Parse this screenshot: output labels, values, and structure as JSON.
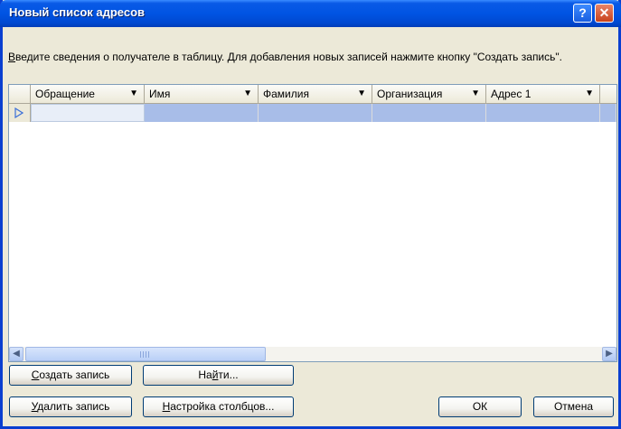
{
  "window": {
    "title": "Новый список адресов",
    "help_glyph": "?",
    "close_glyph": "✕"
  },
  "instructions": {
    "accel": "В",
    "text": "ведите сведения о получателе в таблицу. Для добавления новых записей нажмите кнопку \"Создать запись\"."
  },
  "grid": {
    "columns": [
      "Обращение",
      "Имя",
      "Фамилия",
      "Организация",
      "Адрес 1"
    ],
    "dropdown_glyph": "▼",
    "rows": [
      [
        "",
        "",
        "",
        "",
        ""
      ]
    ]
  },
  "scrollbar": {
    "left_glyph": "◀",
    "right_glyph": "▶"
  },
  "buttons": {
    "new_entry": {
      "accel": "С",
      "rest": "оздать запись"
    },
    "find": {
      "pre": "На",
      "accel": "й",
      "rest": "ти..."
    },
    "delete_entry": {
      "accel": "У",
      "rest": "далить запись"
    },
    "customize": {
      "accel": "Н",
      "rest": "астройка столбцов..."
    },
    "ok": "ОК",
    "cancel": "Отмена"
  },
  "colors": {
    "titlebar": "#0054e3",
    "selection_row": "#a8bde8",
    "dialog_bg": "#ece9d8"
  }
}
